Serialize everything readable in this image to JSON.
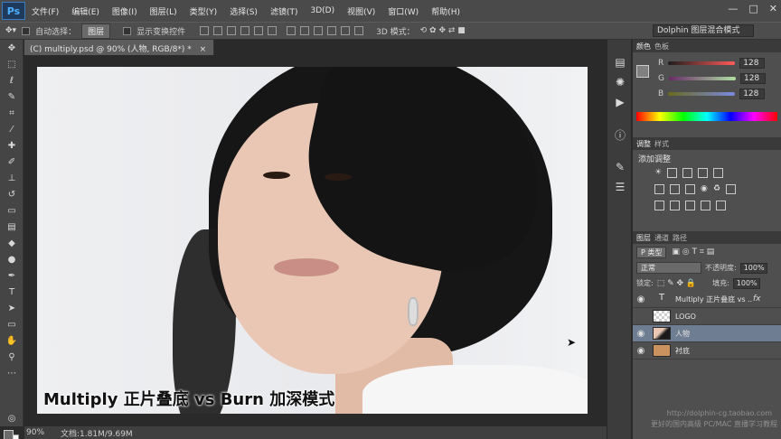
{
  "app": {
    "logo": "Ps"
  },
  "menubar": {
    "items": [
      "文件(F)",
      "编辑(E)",
      "图像(I)",
      "图层(L)",
      "类型(Y)",
      "选择(S)",
      "滤镜(T)",
      "3D(D)",
      "视图(V)",
      "窗口(W)",
      "帮助(H)"
    ],
    "controls": [
      "—",
      "□",
      "✕"
    ]
  },
  "options": {
    "auto_select_label": "自动选择：",
    "auto_select_value": "图层",
    "transform_label": "显示变换控件",
    "mode_3d_label": "3D 模式：",
    "workspace": "Dolphin 图层混合模式"
  },
  "document": {
    "tab_title": "(C) multiply.psd @ 90% (人物, RGB/8*) *",
    "caption": "Multiply 正片叠底 vs Burn 加深模式",
    "zoom": "90%",
    "doc_info": "文档:1.81M/9.69M"
  },
  "color_panel": {
    "tabs": [
      "颜色",
      "色板"
    ],
    "labels": [
      "R",
      "G",
      "B"
    ],
    "values": [
      "128",
      "128",
      "128"
    ],
    "colors": {
      "r": "#c24a4a",
      "g": "#4aa04a",
      "b": "#4a5ac2"
    }
  },
  "adjust_panel": {
    "tabs": [
      "调整",
      "样式"
    ],
    "add_label": "添加调整"
  },
  "layers_panel": {
    "tabs": [
      "图层",
      "通道",
      "路径"
    ],
    "filter_label": "P 类型",
    "blend_mode": "正常",
    "opacity_label": "不透明度:",
    "opacity_value": "100%",
    "lock_label": "锁定:",
    "fill_label": "填充:",
    "fill_value": "100%",
    "layers": [
      {
        "name": "Multiply 正片叠底 vs ...",
        "type": "T",
        "fx": "fx"
      },
      {
        "name": "LOGO"
      },
      {
        "name": "人物"
      },
      {
        "name": "衬底"
      }
    ]
  },
  "watermark": {
    "url": "http://dolphin-cg.taobao.com",
    "tagline": "更好的国内高级 PC/MAC 直播学习教程"
  }
}
